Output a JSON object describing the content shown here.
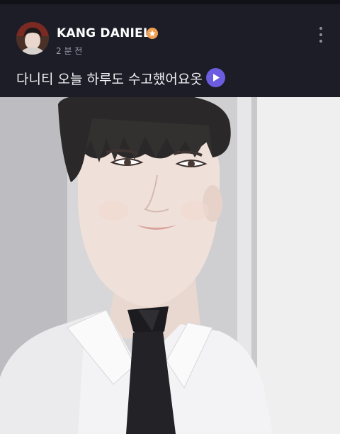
{
  "author": {
    "name": "KANG DANIEL",
    "time": "2 분 전",
    "badge_icon": "verified-badge-icon",
    "badge_color": "#f0a050"
  },
  "post": {
    "text": "다니티 오늘 하루도 수고했어요옷",
    "translate_icon": "play-translate-icon",
    "accent_color": "#6b5ce0"
  },
  "menu": {
    "icon": "more-vertical-icon"
  },
  "theme": {
    "background": "#1d1d27"
  }
}
